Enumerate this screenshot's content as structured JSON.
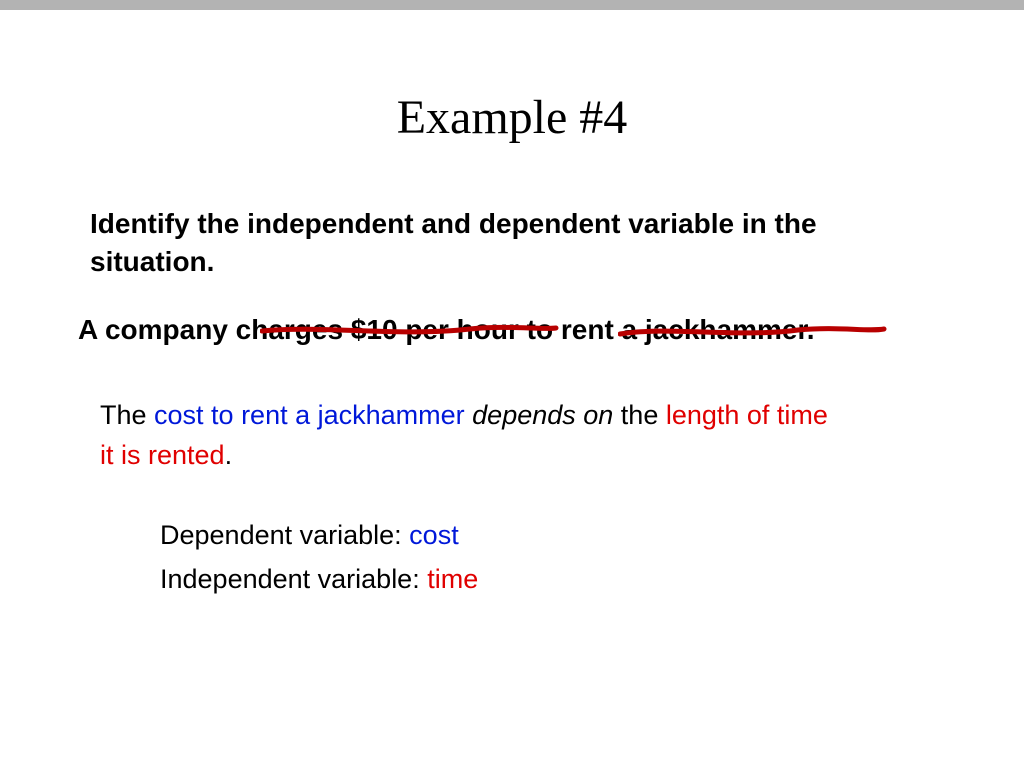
{
  "title": "Example #4",
  "instruction": "Identify the independent and dependent variable in the situation.",
  "problem": "A company charges $10 per hour to rent a jackhammer.",
  "explain": {
    "pre": "The ",
    "dep_phrase": "cost to rent a jackhammer",
    "depends": " depends on ",
    "mid": "the ",
    "indep_phrase": "length of time it is rented",
    "post": "."
  },
  "answers": {
    "dep_label": "Dependent variable: ",
    "dep_value": "cost",
    "indep_label": "Independent variable: ",
    "indep_value": "time"
  },
  "colors": {
    "blue": "#0018d9",
    "red": "#e00000",
    "stroke": "#b80000"
  }
}
